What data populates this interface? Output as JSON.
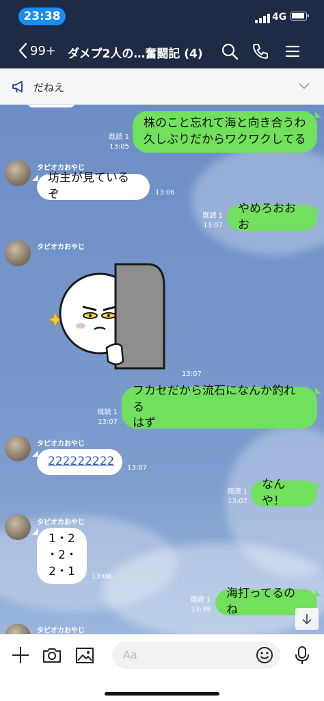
{
  "status_bar": {
    "time": "23:38",
    "network": "4G"
  },
  "header": {
    "back_count": "99+",
    "title": "ダメプ2人の…奮闘記 (4)"
  },
  "notice": {
    "text": "だねえ"
  },
  "messages": [
    {
      "id": "m1",
      "line1": "株のこと忘れて海と向き合うわ",
      "line2": "久しぶりだからワクワクしてる",
      "read": "既読 1",
      "time": "13:05"
    },
    {
      "id": "m2",
      "sender": "タピオカおやじ",
      "text": "坊主が見ているぞ",
      "time": "13:06"
    },
    {
      "id": "m3",
      "text": "やめろおおお",
      "read": "既読 1",
      "time": "13:07"
    },
    {
      "id": "m4",
      "sender": "タピオカおやじ",
      "time": "13:07"
    },
    {
      "id": "m5",
      "line1": "フカセだから流石になんか釣れる",
      "line2": "はず",
      "read": "既読 1",
      "time": "13:07"
    },
    {
      "id": "m6",
      "sender": "タピオカおやじ",
      "text": "222222222",
      "time": "13:07"
    },
    {
      "id": "m7",
      "text": "なんや！",
      "read": "既読 1",
      "time": "13:07"
    },
    {
      "id": "m8",
      "sender": "タピオカおやじ",
      "line1": "1・2",
      "line2": "・2・",
      "line3": "2・1",
      "time": "13:08"
    },
    {
      "id": "m9",
      "text": "海打ってるのね",
      "read": "既読 1",
      "time": "13:39"
    },
    {
      "id": "m10",
      "sender": "タピオカおやじ"
    }
  ],
  "input": {
    "placeholder": "Aa"
  },
  "colors": {
    "header": "#1f2a44",
    "outgoing": "#71e05c",
    "incoming": "#ffffff",
    "accent": "#1a8cf5"
  }
}
